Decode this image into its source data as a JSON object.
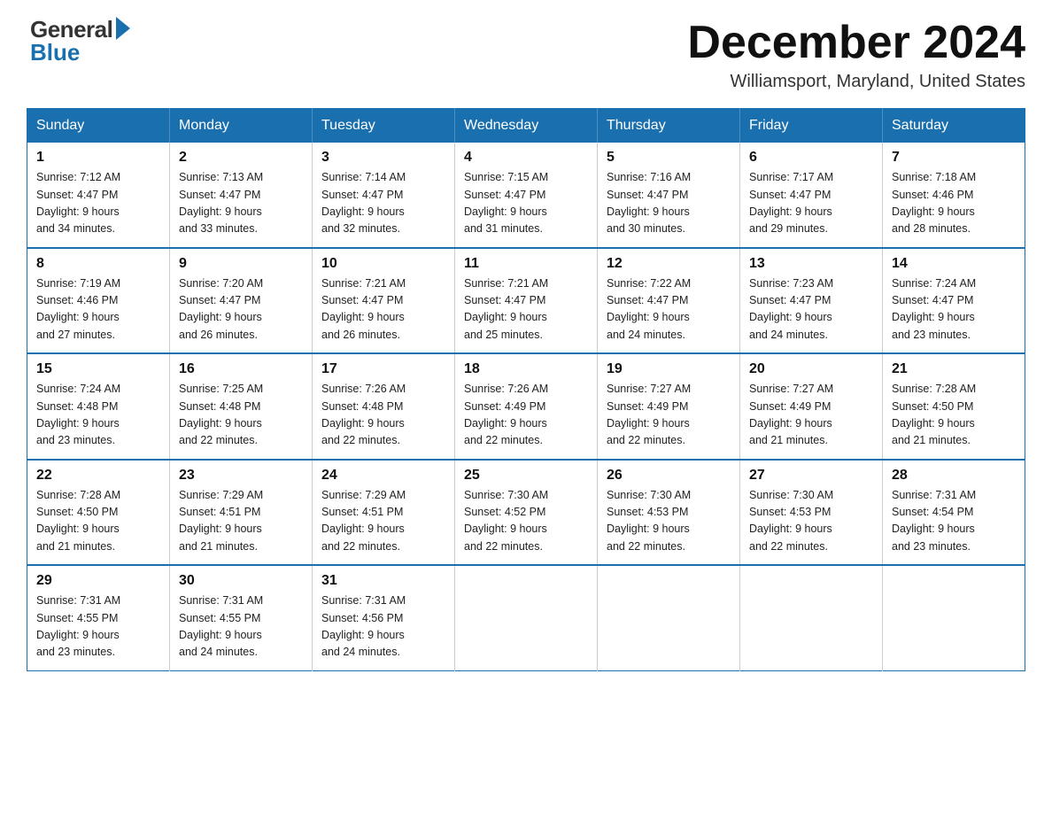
{
  "header": {
    "logo_general": "General",
    "logo_blue": "Blue",
    "month_title": "December 2024",
    "location": "Williamsport, Maryland, United States"
  },
  "days_of_week": [
    "Sunday",
    "Monday",
    "Tuesday",
    "Wednesday",
    "Thursday",
    "Friday",
    "Saturday"
  ],
  "weeks": [
    [
      {
        "day": "1",
        "sunrise": "7:12 AM",
        "sunset": "4:47 PM",
        "daylight": "9 hours and 34 minutes."
      },
      {
        "day": "2",
        "sunrise": "7:13 AM",
        "sunset": "4:47 PM",
        "daylight": "9 hours and 33 minutes."
      },
      {
        "day": "3",
        "sunrise": "7:14 AM",
        "sunset": "4:47 PM",
        "daylight": "9 hours and 32 minutes."
      },
      {
        "day": "4",
        "sunrise": "7:15 AM",
        "sunset": "4:47 PM",
        "daylight": "9 hours and 31 minutes."
      },
      {
        "day": "5",
        "sunrise": "7:16 AM",
        "sunset": "4:47 PM",
        "daylight": "9 hours and 30 minutes."
      },
      {
        "day": "6",
        "sunrise": "7:17 AM",
        "sunset": "4:47 PM",
        "daylight": "9 hours and 29 minutes."
      },
      {
        "day": "7",
        "sunrise": "7:18 AM",
        "sunset": "4:46 PM",
        "daylight": "9 hours and 28 minutes."
      }
    ],
    [
      {
        "day": "8",
        "sunrise": "7:19 AM",
        "sunset": "4:46 PM",
        "daylight": "9 hours and 27 minutes."
      },
      {
        "day": "9",
        "sunrise": "7:20 AM",
        "sunset": "4:47 PM",
        "daylight": "9 hours and 26 minutes."
      },
      {
        "day": "10",
        "sunrise": "7:21 AM",
        "sunset": "4:47 PM",
        "daylight": "9 hours and 26 minutes."
      },
      {
        "day": "11",
        "sunrise": "7:21 AM",
        "sunset": "4:47 PM",
        "daylight": "9 hours and 25 minutes."
      },
      {
        "day": "12",
        "sunrise": "7:22 AM",
        "sunset": "4:47 PM",
        "daylight": "9 hours and 24 minutes."
      },
      {
        "day": "13",
        "sunrise": "7:23 AM",
        "sunset": "4:47 PM",
        "daylight": "9 hours and 24 minutes."
      },
      {
        "day": "14",
        "sunrise": "7:24 AM",
        "sunset": "4:47 PM",
        "daylight": "9 hours and 23 minutes."
      }
    ],
    [
      {
        "day": "15",
        "sunrise": "7:24 AM",
        "sunset": "4:48 PM",
        "daylight": "9 hours and 23 minutes."
      },
      {
        "day": "16",
        "sunrise": "7:25 AM",
        "sunset": "4:48 PM",
        "daylight": "9 hours and 22 minutes."
      },
      {
        "day": "17",
        "sunrise": "7:26 AM",
        "sunset": "4:48 PM",
        "daylight": "9 hours and 22 minutes."
      },
      {
        "day": "18",
        "sunrise": "7:26 AM",
        "sunset": "4:49 PM",
        "daylight": "9 hours and 22 minutes."
      },
      {
        "day": "19",
        "sunrise": "7:27 AM",
        "sunset": "4:49 PM",
        "daylight": "9 hours and 22 minutes."
      },
      {
        "day": "20",
        "sunrise": "7:27 AM",
        "sunset": "4:49 PM",
        "daylight": "9 hours and 21 minutes."
      },
      {
        "day": "21",
        "sunrise": "7:28 AM",
        "sunset": "4:50 PM",
        "daylight": "9 hours and 21 minutes."
      }
    ],
    [
      {
        "day": "22",
        "sunrise": "7:28 AM",
        "sunset": "4:50 PM",
        "daylight": "9 hours and 21 minutes."
      },
      {
        "day": "23",
        "sunrise": "7:29 AM",
        "sunset": "4:51 PM",
        "daylight": "9 hours and 21 minutes."
      },
      {
        "day": "24",
        "sunrise": "7:29 AM",
        "sunset": "4:51 PM",
        "daylight": "9 hours and 22 minutes."
      },
      {
        "day": "25",
        "sunrise": "7:30 AM",
        "sunset": "4:52 PM",
        "daylight": "9 hours and 22 minutes."
      },
      {
        "day": "26",
        "sunrise": "7:30 AM",
        "sunset": "4:53 PM",
        "daylight": "9 hours and 22 minutes."
      },
      {
        "day": "27",
        "sunrise": "7:30 AM",
        "sunset": "4:53 PM",
        "daylight": "9 hours and 22 minutes."
      },
      {
        "day": "28",
        "sunrise": "7:31 AM",
        "sunset": "4:54 PM",
        "daylight": "9 hours and 23 minutes."
      }
    ],
    [
      {
        "day": "29",
        "sunrise": "7:31 AM",
        "sunset": "4:55 PM",
        "daylight": "9 hours and 23 minutes."
      },
      {
        "day": "30",
        "sunrise": "7:31 AM",
        "sunset": "4:55 PM",
        "daylight": "9 hours and 24 minutes."
      },
      {
        "day": "31",
        "sunrise": "7:31 AM",
        "sunset": "4:56 PM",
        "daylight": "9 hours and 24 minutes."
      },
      null,
      null,
      null,
      null
    ]
  ],
  "labels": {
    "sunrise": "Sunrise:",
    "sunset": "Sunset:",
    "daylight": "Daylight:"
  }
}
